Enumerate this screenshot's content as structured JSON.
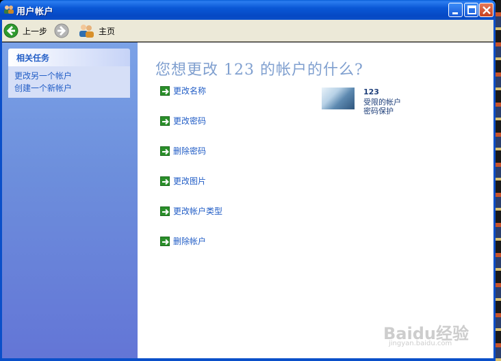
{
  "window": {
    "title": "用户帐户",
    "minimize_icon": "minimize-icon",
    "maximize_icon": "maximize-icon",
    "close_icon": "close-icon"
  },
  "toolbar": {
    "back_label": "上一步",
    "home_label": "主页"
  },
  "sidebar": {
    "header": "相关任务",
    "links": [
      {
        "label": "更改另一个帐户"
      },
      {
        "label": "创建一个新帐户"
      }
    ]
  },
  "main": {
    "heading": "您想更改 123 的帐户的什么?",
    "actions": [
      {
        "label": "更改名称"
      },
      {
        "label": "更改密码"
      },
      {
        "label": "删除密码"
      },
      {
        "label": "更改图片"
      },
      {
        "label": "更改帐户类型"
      },
      {
        "label": "删除帐户"
      }
    ],
    "account": {
      "name": "123",
      "type": "受限的帐户",
      "status": "密码保护"
    }
  },
  "watermark": {
    "text": "Baidu经验",
    "sub": "jingyan.baidu.com"
  },
  "colors": {
    "titlebar": "#0a58d6",
    "link": "#215dc6",
    "heading": "#7f9fcf",
    "action_arrow": "#2a8f2a"
  }
}
